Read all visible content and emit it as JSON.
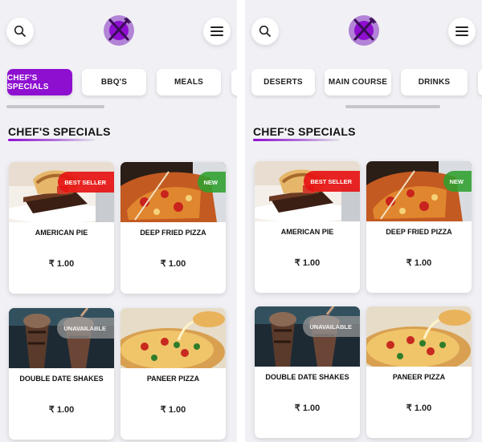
{
  "colors": {
    "accent": "#8e0fd0",
    "badge_red": "#e61414",
    "badge_green": "#2ea02e",
    "badge_grey": "#969696",
    "background": "#f1f1f5"
  },
  "icons": {
    "search": "search-icon",
    "menu": "hamburger-menu-icon",
    "logo": "crossed-fork-knife-logo"
  },
  "left_panel": {
    "tabs": [
      {
        "label": "CHEF'S SPECIALS",
        "active": true
      },
      {
        "label": "BBQ'S",
        "active": false
      },
      {
        "label": "MEALS",
        "active": false
      }
    ],
    "tab_scroll": {
      "position": 0.0
    },
    "section_title": "CHEF'S SPECIALS",
    "items": [
      {
        "name": "AMERICAN PIE",
        "price": "₹ 1.00",
        "badge": "BEST SELLER",
        "badge_type": "red",
        "image": "chocolate-cake"
      },
      {
        "name": "DEEP FRIED PIZZA",
        "price": "₹ 1.00",
        "badge": "NEW",
        "badge_type": "green",
        "image": "pizza-slice"
      },
      {
        "name": "DOUBLE DATE SHAKES",
        "price": "₹ 1.00",
        "badge": "UNAVAILABLE",
        "badge_type": "grey",
        "image": "chocolate-shakes"
      },
      {
        "name": "PANEER PIZZA",
        "price": "₹ 1.00",
        "badge": "",
        "badge_type": "",
        "image": "cheese-pizza"
      }
    ]
  },
  "right_panel": {
    "tabs": [
      {
        "label": "DESERTS",
        "active": false
      },
      {
        "label": "MAIN COURSE",
        "active": false
      },
      {
        "label": "DRINKS",
        "active": false
      }
    ],
    "tab_scroll": {
      "position": 0.5
    },
    "section_title": "CHEF'S SPECIALS",
    "items": [
      {
        "name": "AMERICAN PIE",
        "price": "₹ 1.00",
        "badge": "BEST SELLER",
        "badge_type": "red",
        "image": "chocolate-cake"
      },
      {
        "name": "DEEP FRIED PIZZA",
        "price": "₹ 1.00",
        "badge": "NEW",
        "badge_type": "green",
        "image": "pizza-slice"
      },
      {
        "name": "DOUBLE DATE SHAKES",
        "price": "₹ 1.00",
        "badge": "UNAVAILABLE",
        "badge_type": "grey",
        "image": "chocolate-shakes"
      },
      {
        "name": "PANEER PIZZA",
        "price": "₹ 1.00",
        "badge": "",
        "badge_type": "",
        "image": "cheese-pizza"
      }
    ]
  }
}
